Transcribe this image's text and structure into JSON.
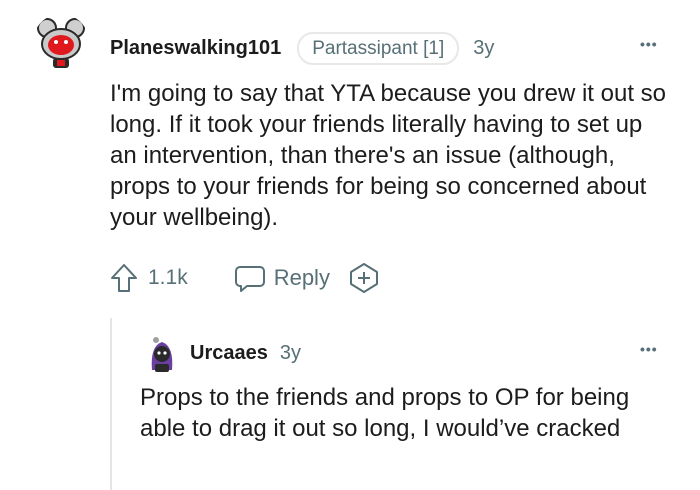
{
  "parent": {
    "username": "Planeswalking101",
    "flair": "Partassipant [1]",
    "age": "3y",
    "more_label": "•••",
    "body": "I'm going to say that YTA because you drew it out so long. If it took your friends literally having to set up an intervention, than there's an issue (although, props to your friends for being so concerned about your wellbeing).",
    "upvote_count": "1.1k",
    "reply_label": "Reply",
    "upvote_icon": "upvote-arrow-icon",
    "reply_icon": "speech-bubble-icon",
    "award_icon": "award-plus-icon"
  },
  "reply": {
    "username": "Urcaaes",
    "age": "3y",
    "more_label": "•••",
    "body": "Props to the friends and props to OP for being able to drag it out so long, I would’ve cracked"
  },
  "colors": {
    "text": "#1c1c1c",
    "meta": "#576f76",
    "flair_border": "#e8e8e8",
    "thread_line": "#e5e5e5"
  }
}
